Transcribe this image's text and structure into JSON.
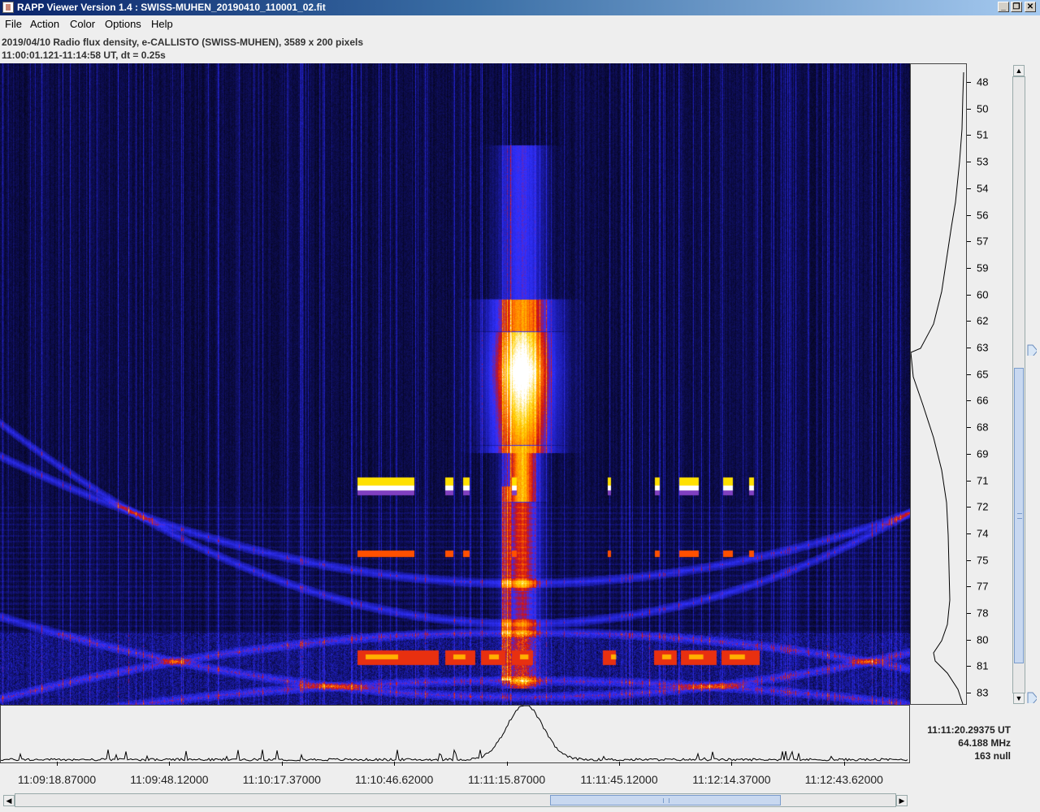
{
  "window": {
    "title": "RAPP Viewer Version 1.4 : SWISS-MUHEN_20190410_110001_02.fit",
    "minimize_glyph": "_",
    "restore_glyph": "❐",
    "close_glyph": "✕"
  },
  "menu": {
    "items": [
      "File",
      "Action",
      "Color",
      "Options",
      "Help"
    ]
  },
  "info": {
    "line1": "2019/04/10  Radio flux density, e-CALLISTO (SWISS-MUHEN),  3589 x 200 pixels",
    "line2": "11:00:01.121-11:14:58 UT,  dt = 0.25s"
  },
  "frequency_axis": {
    "labels": [
      "48",
      "50",
      "51",
      "53",
      "54",
      "56",
      "57",
      "59",
      "60",
      "62",
      "63",
      "65",
      "66",
      "68",
      "69",
      "71",
      "72",
      "74",
      "75",
      "77",
      "78",
      "80",
      "81",
      "83"
    ],
    "unit": "MHz"
  },
  "time_axis": {
    "labels": [
      "11:09:18.87000",
      "11:09:48.12000",
      "11:10:17.37000",
      "11:10:46.62000",
      "11:11:15.87000",
      "11:11:45.12000",
      "11:12:14.37000",
      "11:12:43.62000"
    ]
  },
  "readout": {
    "time": "11:11:20.29375 UT",
    "frequency": "64.188 MHz",
    "value": "163 null"
  },
  "scrollbars": {
    "up_arrow": "▲",
    "down_arrow": "▼",
    "left_arrow": "◀",
    "right_arrow": "▶"
  },
  "colors": {
    "colormap": [
      "#000000",
      "#1a1aa8",
      "#3030ff",
      "#d01010",
      "#ff7000",
      "#ffd000",
      "#ffffff"
    ],
    "titlebar_start": "#0a246a",
    "titlebar_end": "#a6caf0"
  }
}
